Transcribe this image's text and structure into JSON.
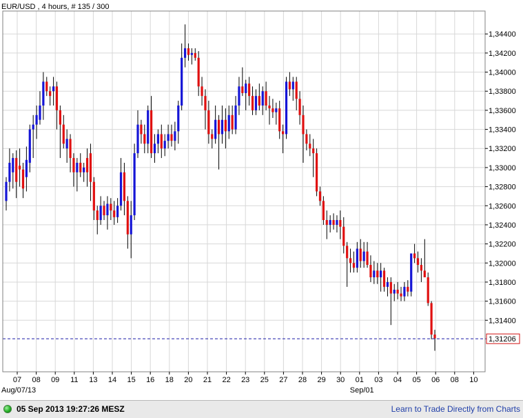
{
  "header": {
    "title": "EUR/USD , 4 hours, # 135 / 300"
  },
  "status_bar": {
    "timestamp": "05 Sep 2013 19:27:26 MESZ",
    "link_text": "Learn to Trade Directly from Charts"
  },
  "colors": {
    "bull": "#1515d6",
    "bear": "#e01010",
    "wick": "#000000",
    "grid": "#d7d7d7",
    "last_price_line": "#1a1aa8",
    "last_price_box": "#d01010"
  },
  "chart_data": {
    "type": "candlestick",
    "title": "EUR/USD , 4 hours, # 135 / 300",
    "y_ticks": [
      "1,31400",
      "1,31600",
      "1,31800",
      "1,32000",
      "1,32200",
      "1,32400",
      "1,32600",
      "1,32800",
      "1,33000",
      "1,33200",
      "1,33400",
      "1,33600",
      "1,33800",
      "1,34000",
      "1,34200",
      "1,34400"
    ],
    "y_tick_values": [
      1.314,
      1.316,
      1.318,
      1.32,
      1.322,
      1.324,
      1.326,
      1.328,
      1.33,
      1.332,
      1.334,
      1.336,
      1.338,
      1.34,
      1.342,
      1.344
    ],
    "ylim": [
      1.3086,
      1.3464
    ],
    "x_ticks": [
      "07",
      "08",
      "09",
      "11",
      "13",
      "14",
      "15",
      "16",
      "18",
      "20",
      "21",
      "22",
      "23",
      "25",
      "27",
      "28",
      "29",
      "30",
      "01",
      "03",
      "04",
      "05",
      "06",
      "08",
      "10"
    ],
    "x_sublabels": [
      {
        "text": "Aug/07/13",
        "at_tick": 0
      },
      {
        "text": "Sep/01",
        "at_tick": 18
      }
    ],
    "last_price": "1,31206",
    "last_price_value": 1.31206,
    "candles": [
      {
        "o": 1.3265,
        "h": 1.329,
        "l": 1.3255,
        "c": 1.3285
      },
      {
        "o": 1.3285,
        "h": 1.332,
        "l": 1.3275,
        "c": 1.3305
      },
      {
        "o": 1.3295,
        "h": 1.3315,
        "l": 1.3278,
        "c": 1.331
      },
      {
        "o": 1.331,
        "h": 1.3318,
        "l": 1.3268,
        "c": 1.3285
      },
      {
        "o": 1.3302,
        "h": 1.332,
        "l": 1.328,
        "c": 1.3298
      },
      {
        "o": 1.3298,
        "h": 1.3305,
        "l": 1.3268,
        "c": 1.3278
      },
      {
        "o": 1.329,
        "h": 1.3322,
        "l": 1.3275,
        "c": 1.3308
      },
      {
        "o": 1.3305,
        "h": 1.3345,
        "l": 1.3295,
        "c": 1.334
      },
      {
        "o": 1.334,
        "h": 1.3355,
        "l": 1.331,
        "c": 1.3345
      },
      {
        "o": 1.3345,
        "h": 1.3365,
        "l": 1.333,
        "c": 1.3355
      },
      {
        "o": 1.335,
        "h": 1.338,
        "l": 1.3345,
        "c": 1.3365
      },
      {
        "o": 1.3365,
        "h": 1.34,
        "l": 1.335,
        "c": 1.339
      },
      {
        "o": 1.339,
        "h": 1.3395,
        "l": 1.3375,
        "c": 1.338
      },
      {
        "o": 1.338,
        "h": 1.3385,
        "l": 1.3365,
        "c": 1.3375
      },
      {
        "o": 1.338,
        "h": 1.3395,
        "l": 1.3365,
        "c": 1.3385
      },
      {
        "o": 1.3385,
        "h": 1.339,
        "l": 1.334,
        "c": 1.336
      },
      {
        "o": 1.336,
        "h": 1.3365,
        "l": 1.331,
        "c": 1.3345
      },
      {
        "o": 1.3345,
        "h": 1.3355,
        "l": 1.332,
        "c": 1.3325
      },
      {
        "o": 1.332,
        "h": 1.334,
        "l": 1.3305,
        "c": 1.333
      },
      {
        "o": 1.333,
        "h": 1.3335,
        "l": 1.3295,
        "c": 1.331
      },
      {
        "o": 1.331,
        "h": 1.3315,
        "l": 1.328,
        "c": 1.3295
      },
      {
        "o": 1.3295,
        "h": 1.331,
        "l": 1.3275,
        "c": 1.3305
      },
      {
        "o": 1.3305,
        "h": 1.3315,
        "l": 1.329,
        "c": 1.3295
      },
      {
        "o": 1.3295,
        "h": 1.3305,
        "l": 1.3285,
        "c": 1.33
      },
      {
        "o": 1.331,
        "h": 1.332,
        "l": 1.328,
        "c": 1.3295
      },
      {
        "o": 1.3315,
        "h": 1.3325,
        "l": 1.3265,
        "c": 1.3285
      },
      {
        "o": 1.3285,
        "h": 1.329,
        "l": 1.3245,
        "c": 1.3255
      },
      {
        "o": 1.3255,
        "h": 1.326,
        "l": 1.323,
        "c": 1.3245
      },
      {
        "o": 1.3245,
        "h": 1.327,
        "l": 1.324,
        "c": 1.326
      },
      {
        "o": 1.326,
        "h": 1.3265,
        "l": 1.3245,
        "c": 1.325
      },
      {
        "o": 1.325,
        "h": 1.327,
        "l": 1.3235,
        "c": 1.3262
      },
      {
        "o": 1.3262,
        "h": 1.3268,
        "l": 1.3245,
        "c": 1.3255
      },
      {
        "o": 1.3255,
        "h": 1.3265,
        "l": 1.324,
        "c": 1.3248
      },
      {
        "o": 1.3248,
        "h": 1.3268,
        "l": 1.3242,
        "c": 1.326
      },
      {
        "o": 1.326,
        "h": 1.331,
        "l": 1.3255,
        "c": 1.3295
      },
      {
        "o": 1.3295,
        "h": 1.3305,
        "l": 1.325,
        "c": 1.3265
      },
      {
        "o": 1.3265,
        "h": 1.327,
        "l": 1.3215,
        "c": 1.323
      },
      {
        "o": 1.323,
        "h": 1.3265,
        "l": 1.3205,
        "c": 1.325
      },
      {
        "o": 1.325,
        "h": 1.3325,
        "l": 1.3245,
        "c": 1.3315
      },
      {
        "o": 1.3315,
        "h": 1.336,
        "l": 1.331,
        "c": 1.3345
      },
      {
        "o": 1.3345,
        "h": 1.335,
        "l": 1.3325,
        "c": 1.3335
      },
      {
        "o": 1.3335,
        "h": 1.3345,
        "l": 1.3315,
        "c": 1.3325
      },
      {
        "o": 1.3325,
        "h": 1.3365,
        "l": 1.3315,
        "c": 1.336
      },
      {
        "o": 1.336,
        "h": 1.3375,
        "l": 1.331,
        "c": 1.3315
      },
      {
        "o": 1.3315,
        "h": 1.3335,
        "l": 1.3305,
        "c": 1.3325
      },
      {
        "o": 1.3325,
        "h": 1.334,
        "l": 1.3315,
        "c": 1.3335
      },
      {
        "o": 1.3335,
        "h": 1.3345,
        "l": 1.331,
        "c": 1.332
      },
      {
        "o": 1.332,
        "h": 1.3335,
        "l": 1.3312,
        "c": 1.3328
      },
      {
        "o": 1.3328,
        "h": 1.3345,
        "l": 1.332,
        "c": 1.3335
      },
      {
        "o": 1.3335,
        "h": 1.3345,
        "l": 1.3322,
        "c": 1.3328
      },
      {
        "o": 1.3328,
        "h": 1.3348,
        "l": 1.3318,
        "c": 1.3338
      },
      {
        "o": 1.3338,
        "h": 1.337,
        "l": 1.3325,
        "c": 1.3365
      },
      {
        "o": 1.3365,
        "h": 1.343,
        "l": 1.336,
        "c": 1.3415
      },
      {
        "o": 1.3415,
        "h": 1.345,
        "l": 1.3405,
        "c": 1.3425
      },
      {
        "o": 1.3425,
        "h": 1.343,
        "l": 1.3412,
        "c": 1.3418
      },
      {
        "o": 1.3418,
        "h": 1.3425,
        "l": 1.3408,
        "c": 1.342
      },
      {
        "o": 1.342,
        "h": 1.3425,
        "l": 1.3412,
        "c": 1.3415
      },
      {
        "o": 1.3415,
        "h": 1.3422,
        "l": 1.3375,
        "c": 1.3385
      },
      {
        "o": 1.3385,
        "h": 1.3395,
        "l": 1.3365,
        "c": 1.3375
      },
      {
        "o": 1.3375,
        "h": 1.3382,
        "l": 1.334,
        "c": 1.336
      },
      {
        "o": 1.336,
        "h": 1.337,
        "l": 1.3325,
        "c": 1.3335
      },
      {
        "o": 1.3335,
        "h": 1.334,
        "l": 1.332,
        "c": 1.333
      },
      {
        "o": 1.333,
        "h": 1.3365,
        "l": 1.3325,
        "c": 1.335
      },
      {
        "o": 1.335,
        "h": 1.3355,
        "l": 1.3298,
        "c": 1.3335
      },
      {
        "o": 1.3335,
        "h": 1.3365,
        "l": 1.3325,
        "c": 1.335
      },
      {
        "o": 1.335,
        "h": 1.3362,
        "l": 1.332,
        "c": 1.3338
      },
      {
        "o": 1.3338,
        "h": 1.3365,
        "l": 1.333,
        "c": 1.3355
      },
      {
        "o": 1.3355,
        "h": 1.3365,
        "l": 1.3335,
        "c": 1.334
      },
      {
        "o": 1.334,
        "h": 1.3375,
        "l": 1.3335,
        "c": 1.3365
      },
      {
        "o": 1.3365,
        "h": 1.3395,
        "l": 1.3355,
        "c": 1.3385
      },
      {
        "o": 1.3385,
        "h": 1.3405,
        "l": 1.3375,
        "c": 1.3378
      },
      {
        "o": 1.3378,
        "h": 1.3392,
        "l": 1.336,
        "c": 1.3388
      },
      {
        "o": 1.3388,
        "h": 1.3395,
        "l": 1.3365,
        "c": 1.3375
      },
      {
        "o": 1.3375,
        "h": 1.3385,
        "l": 1.3355,
        "c": 1.336
      },
      {
        "o": 1.336,
        "h": 1.3382,
        "l": 1.3355,
        "c": 1.3375
      },
      {
        "o": 1.3375,
        "h": 1.3388,
        "l": 1.336,
        "c": 1.3365
      },
      {
        "o": 1.3365,
        "h": 1.3385,
        "l": 1.3355,
        "c": 1.338
      },
      {
        "o": 1.338,
        "h": 1.339,
        "l": 1.336,
        "c": 1.3365
      },
      {
        "o": 1.3365,
        "h": 1.3375,
        "l": 1.3345,
        "c": 1.3362
      },
      {
        "o": 1.3362,
        "h": 1.3372,
        "l": 1.3352,
        "c": 1.3358
      },
      {
        "o": 1.3358,
        "h": 1.3368,
        "l": 1.3345,
        "c": 1.3362
      },
      {
        "o": 1.3362,
        "h": 1.337,
        "l": 1.333,
        "c": 1.3338
      },
      {
        "o": 1.3338,
        "h": 1.3345,
        "l": 1.3315,
        "c": 1.3335
      },
      {
        "o": 1.3335,
        "h": 1.3395,
        "l": 1.333,
        "c": 1.339
      },
      {
        "o": 1.339,
        "h": 1.34,
        "l": 1.3375,
        "c": 1.3382
      },
      {
        "o": 1.3382,
        "h": 1.3395,
        "l": 1.337,
        "c": 1.339
      },
      {
        "o": 1.339,
        "h": 1.3395,
        "l": 1.336,
        "c": 1.3372
      },
      {
        "o": 1.3372,
        "h": 1.338,
        "l": 1.3345,
        "c": 1.3355
      },
      {
        "o": 1.3355,
        "h": 1.3365,
        "l": 1.3305,
        "c": 1.3335
      },
      {
        "o": 1.3335,
        "h": 1.334,
        "l": 1.3318,
        "c": 1.3325
      },
      {
        "o": 1.3325,
        "h": 1.3335,
        "l": 1.3312,
        "c": 1.332
      },
      {
        "o": 1.332,
        "h": 1.333,
        "l": 1.329,
        "c": 1.3315
      },
      {
        "o": 1.3315,
        "h": 1.332,
        "l": 1.327,
        "c": 1.3275
      },
      {
        "o": 1.3275,
        "h": 1.328,
        "l": 1.326,
        "c": 1.3265
      },
      {
        "o": 1.3265,
        "h": 1.327,
        "l": 1.324,
        "c": 1.3245
      },
      {
        "o": 1.3245,
        "h": 1.3255,
        "l": 1.3225,
        "c": 1.324
      },
      {
        "o": 1.324,
        "h": 1.325,
        "l": 1.3232,
        "c": 1.3245
      },
      {
        "o": 1.3245,
        "h": 1.3252,
        "l": 1.3235,
        "c": 1.324
      },
      {
        "o": 1.324,
        "h": 1.325,
        "l": 1.3232,
        "c": 1.3245
      },
      {
        "o": 1.3245,
        "h": 1.3255,
        "l": 1.3225,
        "c": 1.3238
      },
      {
        "o": 1.3238,
        "h": 1.3248,
        "l": 1.321,
        "c": 1.3218
      },
      {
        "o": 1.3218,
        "h": 1.3222,
        "l": 1.3175,
        "c": 1.3205
      },
      {
        "o": 1.3205,
        "h": 1.3215,
        "l": 1.319,
        "c": 1.32
      },
      {
        "o": 1.32,
        "h": 1.3212,
        "l": 1.319,
        "c": 1.3195
      },
      {
        "o": 1.3195,
        "h": 1.3222,
        "l": 1.319,
        "c": 1.3215
      },
      {
        "o": 1.3215,
        "h": 1.3225,
        "l": 1.3195,
        "c": 1.3202
      },
      {
        "o": 1.3202,
        "h": 1.3222,
        "l": 1.3195,
        "c": 1.3212
      },
      {
        "o": 1.3212,
        "h": 1.3222,
        "l": 1.3195,
        "c": 1.3198
      },
      {
        "o": 1.3198,
        "h": 1.3208,
        "l": 1.318,
        "c": 1.3185
      },
      {
        "o": 1.3185,
        "h": 1.3202,
        "l": 1.3178,
        "c": 1.3192
      },
      {
        "o": 1.3192,
        "h": 1.32,
        "l": 1.3178,
        "c": 1.3185
      },
      {
        "o": 1.3185,
        "h": 1.32,
        "l": 1.317,
        "c": 1.3192
      },
      {
        "o": 1.3192,
        "h": 1.3195,
        "l": 1.317,
        "c": 1.3175
      },
      {
        "o": 1.3175,
        "h": 1.3185,
        "l": 1.3165,
        "c": 1.318
      },
      {
        "o": 1.318,
        "h": 1.3185,
        "l": 1.3135,
        "c": 1.3168
      },
      {
        "o": 1.3168,
        "h": 1.3178,
        "l": 1.316,
        "c": 1.3172
      },
      {
        "o": 1.3172,
        "h": 1.318,
        "l": 1.3162,
        "c": 1.3168
      },
      {
        "o": 1.3168,
        "h": 1.3175,
        "l": 1.316,
        "c": 1.3165
      },
      {
        "o": 1.3165,
        "h": 1.318,
        "l": 1.316,
        "c": 1.3175
      },
      {
        "o": 1.3175,
        "h": 1.3182,
        "l": 1.3165,
        "c": 1.317
      },
      {
        "o": 1.317,
        "h": 1.3205,
        "l": 1.3165,
        "c": 1.321
      },
      {
        "o": 1.321,
        "h": 1.322,
        "l": 1.32,
        "c": 1.3205
      },
      {
        "o": 1.3205,
        "h": 1.3212,
        "l": 1.319,
        "c": 1.3198
      },
      {
        "o": 1.3198,
        "h": 1.3205,
        "l": 1.318,
        "c": 1.3192
      },
      {
        "o": 1.3192,
        "h": 1.3225,
        "l": 1.3185,
        "c": 1.3185
      },
      {
        "o": 1.3185,
        "h": 1.319,
        "l": 1.3155,
        "c": 1.3158
      },
      {
        "o": 1.3158,
        "h": 1.316,
        "l": 1.312,
        "c": 1.3125
      },
      {
        "o": 1.3125,
        "h": 1.313,
        "l": 1.3108,
        "c": 1.3121
      }
    ]
  }
}
